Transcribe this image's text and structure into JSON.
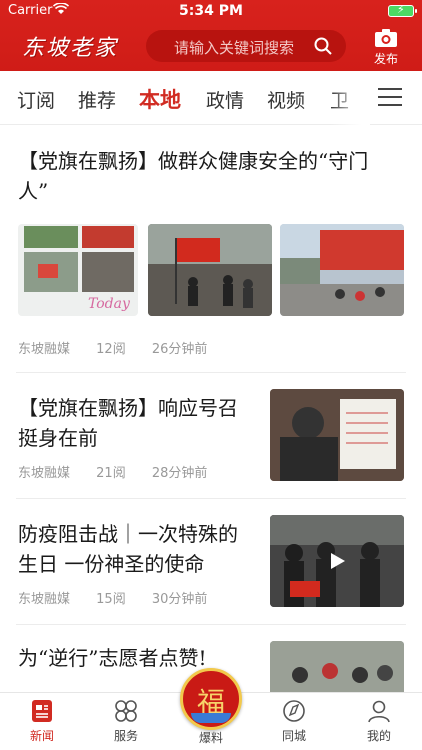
{
  "status_bar": {
    "carrier": "Carrier",
    "time": "5:34 PM"
  },
  "header": {
    "logo_text": "东坡老家",
    "search_placeholder": "请输入关键词搜索",
    "publish_label": "发布",
    "accent": "#d8221d"
  },
  "tabs": [
    {
      "label": "订阅",
      "active": false
    },
    {
      "label": "推荐",
      "active": false
    },
    {
      "label": "本地",
      "active": true
    },
    {
      "label": "政情",
      "active": false
    },
    {
      "label": "视频",
      "active": false
    },
    {
      "label": "卫",
      "active": false
    }
  ],
  "articles": [
    {
      "title": "【党旗在飘扬】做群众健康安全的“守门人”",
      "source": "东坡融媒",
      "reads": "12阅",
      "time": "26分钟前",
      "layout": "three-images"
    },
    {
      "title": "【党旗在飘扬】响应号召挺身在前",
      "source": "东坡融媒",
      "reads": "21阅",
      "time": "28分钟前",
      "layout": "right-image"
    },
    {
      "title": "防疫阻击战｜一次特殊的生日 一份神圣的使命",
      "source": "东坡融媒",
      "reads": "15阅",
      "time": "30分钟前",
      "layout": "right-video"
    },
    {
      "title": "为“逆行”志愿者点赞!",
      "source": "",
      "reads": "",
      "time": "",
      "layout": "right-image"
    }
  ],
  "tabbar": {
    "items": [
      {
        "label": "新闻",
        "icon": "news-icon",
        "active": true
      },
      {
        "label": "服务",
        "icon": "service-icon",
        "active": false
      },
      {
        "label": "爆料",
        "icon": "fu-badge-icon",
        "active": false
      },
      {
        "label": "同城",
        "icon": "city-icon",
        "active": false
      },
      {
        "label": "我的",
        "icon": "profile-icon",
        "active": false
      }
    ],
    "fu_glyph": "福"
  }
}
